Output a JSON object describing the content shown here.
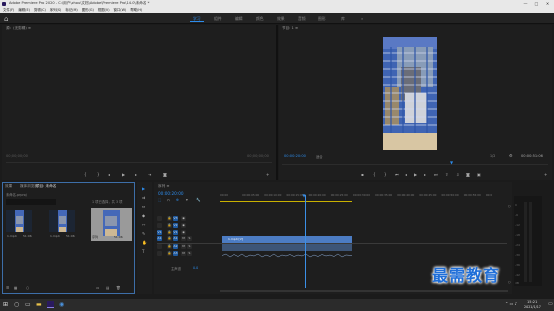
{
  "window": {
    "title": "Adobe Premiere Pro 2020 - C:\\用户\\zhou\\文档\\Adobe\\Premiere Pro\\14.0\\未命名 *",
    "min": "—",
    "max": "□",
    "close": "✕"
  },
  "menu": [
    "文件(F)",
    "编辑(E)",
    "剪辑(C)",
    "序列(S)",
    "标记(M)",
    "图形(G)",
    "视图(V)",
    "窗口(W)",
    "帮助(H)"
  ],
  "workspaces": [
    {
      "label": "学习",
      "active": true
    },
    {
      "label": "组件",
      "active": false
    },
    {
      "label": "编辑",
      "active": false
    },
    {
      "label": "颜色",
      "active": false
    },
    {
      "label": "效果",
      "active": false
    },
    {
      "label": "音频",
      "active": false
    },
    {
      "label": "图形",
      "active": false
    },
    {
      "label": "库",
      "active": false
    },
    {
      "label": "»",
      "active": false
    }
  ],
  "source_panel": {
    "title": "源：(无剪辑) ≡",
    "tc_left": "00;00;00;00",
    "tc_right": "00;00;00;00"
  },
  "program_panel": {
    "title": "节目: 1 ≡",
    "timecode": "00:00:20:00",
    "fit": "适合",
    "ratio": "1/2",
    "duration": "00:00:51:06"
  },
  "project_panel": {
    "tabs": [
      "项目: 未命名",
      "效果",
      "媒体浏览器"
    ],
    "search_placeholder": "",
    "path": "未命名.prproj",
    "count": "1 项已选择，共 3 项",
    "items": [
      {
        "label": "1.mp4",
        "dur": "51:06"
      },
      {
        "label": "1.mp4",
        "dur": "51:06"
      },
      {
        "label": "序列",
        "dur": "51:06"
      }
    ]
  },
  "timeline": {
    "title": "序列 ≡",
    "timecode": "00:00:20:00",
    "ruler": [
      "00:00",
      "00:00:05:00",
      "00:00:10:00",
      "00:00:15:00",
      "00:00:20:00",
      "00:00:25:00",
      "00:00:30:00",
      "00:00:35:00",
      "00:00:40:00",
      "00:00:45:00",
      "00:00:50:00",
      "00:00:55:00",
      "00:0"
    ],
    "tracks": [
      "V3",
      "V2",
      "V1",
      "A1",
      "A2",
      "A3",
      "主声道"
    ],
    "master_value": "0.0",
    "clip_label": "1.mp4 [V]"
  },
  "taskbar": {
    "time": "15:21",
    "date": "2021/1/17"
  },
  "watermark": "最需教育"
}
